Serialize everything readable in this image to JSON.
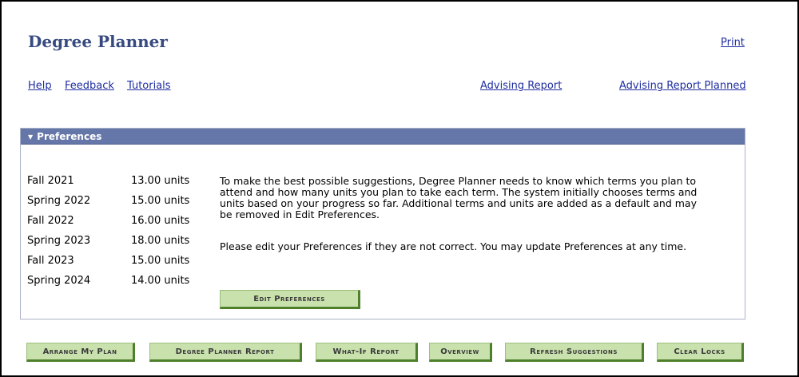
{
  "page": {
    "title": "Degree Planner",
    "print_link": "Print"
  },
  "nav": {
    "help": "Help",
    "feedback": "Feedback",
    "tutorials": "Tutorials",
    "advising_report": "Advising Report",
    "advising_report_planned": "Advising Report Planned"
  },
  "preferences": {
    "header": "Preferences",
    "terms": [
      {
        "term": "Fall 2021",
        "units": "13.00 units"
      },
      {
        "term": "Spring 2022",
        "units": "15.00 units"
      },
      {
        "term": "Fall 2022",
        "units": "16.00 units"
      },
      {
        "term": "Spring 2023",
        "units": "18.00 units"
      },
      {
        "term": "Fall 2023",
        "units": "15.00 units"
      },
      {
        "term": "Spring 2024",
        "units": "14.00 units"
      }
    ],
    "info_lines": [
      "To make the best possible suggestions, Degree Planner needs to know which terms you plan to",
      "attend and how many units you plan to take each term. The system initially chooses terms and",
      "units based on your progress so far. Additional terms and units are added as a default and may",
      "be removed in Edit Preferences."
    ],
    "note": "Please edit your Preferences if they are not correct. You may update Preferences at any time.",
    "edit_button": "Edit Preferences"
  },
  "actions": {
    "arrange_my_plan": "Arrange My Plan",
    "degree_planner_report": "Degree Planner Report",
    "what_if_report": "What-If Report",
    "overview": "Overview",
    "refresh_suggestions": "Refresh Suggestions",
    "clear_locks": "Clear Locks"
  }
}
